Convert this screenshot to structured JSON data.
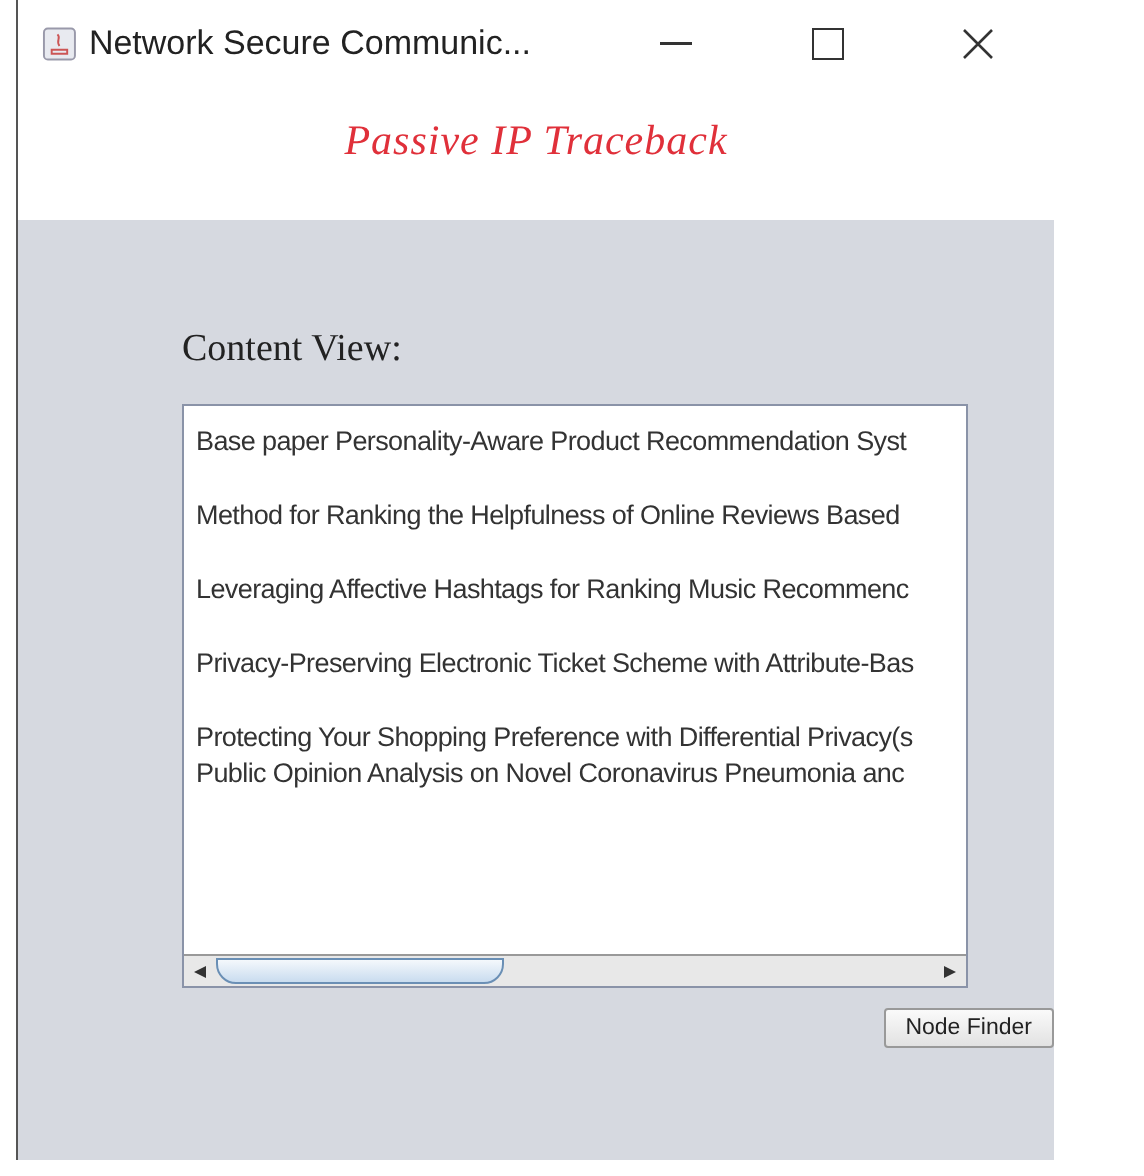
{
  "window": {
    "title": "Network Secure Communic..."
  },
  "header": {
    "title": "Passive IP Traceback"
  },
  "content_label": "Content View:",
  "content_paragraphs": [
    [
      "Base paper Personality-Aware Product Recommendation Syst"
    ],
    [
      "Method for Ranking the Helpfulness of Online Reviews Based"
    ],
    [
      "Leveraging Affective Hashtags for Ranking Music Recommenc"
    ],
    [
      "Privacy-Preserving Electronic Ticket Scheme with Attribute-Bas"
    ],
    [
      "Protecting Your Shopping Preference with Differential Privacy(s",
      "Public Opinion Analysis on Novel Coronavirus Pneumonia anc"
    ]
  ],
  "buttons": [
    "Node Finder"
  ]
}
